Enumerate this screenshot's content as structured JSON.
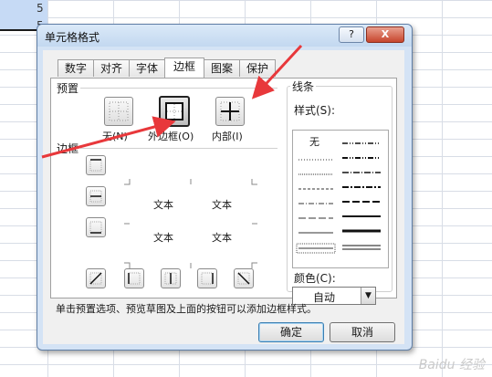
{
  "sheet": {
    "row_numbers": [
      "5",
      "5"
    ]
  },
  "dialog": {
    "title": "单元格格式",
    "help_label": "?",
    "close_label": "X",
    "tabs": [
      {
        "label": "数字"
      },
      {
        "label": "对齐"
      },
      {
        "label": "字体"
      },
      {
        "label": "边框",
        "active": true
      },
      {
        "label": "图案"
      },
      {
        "label": "保护"
      }
    ],
    "presets": {
      "group_label": "预置",
      "items": [
        {
          "label": "无(N)"
        },
        {
          "label": "外边框(O)"
        },
        {
          "label": "内部(I)"
        }
      ]
    },
    "border": {
      "group_label": "边框",
      "preview_texts": [
        "文本",
        "文本",
        "文本",
        "文本"
      ]
    },
    "line": {
      "group_label": "线条",
      "style_label": "样式(S):",
      "none_label": "无",
      "color_label": "颜色(C):",
      "color_value": "自动"
    },
    "hint": "单击预置选项、预览草图及上面的按钮可以添加边框样式。",
    "ok_label": "确定",
    "cancel_label": "取消"
  },
  "watermark": "Baidu 经验",
  "colors": {
    "arrow": "#e8383b",
    "selected_cells": "#c6daf5"
  }
}
